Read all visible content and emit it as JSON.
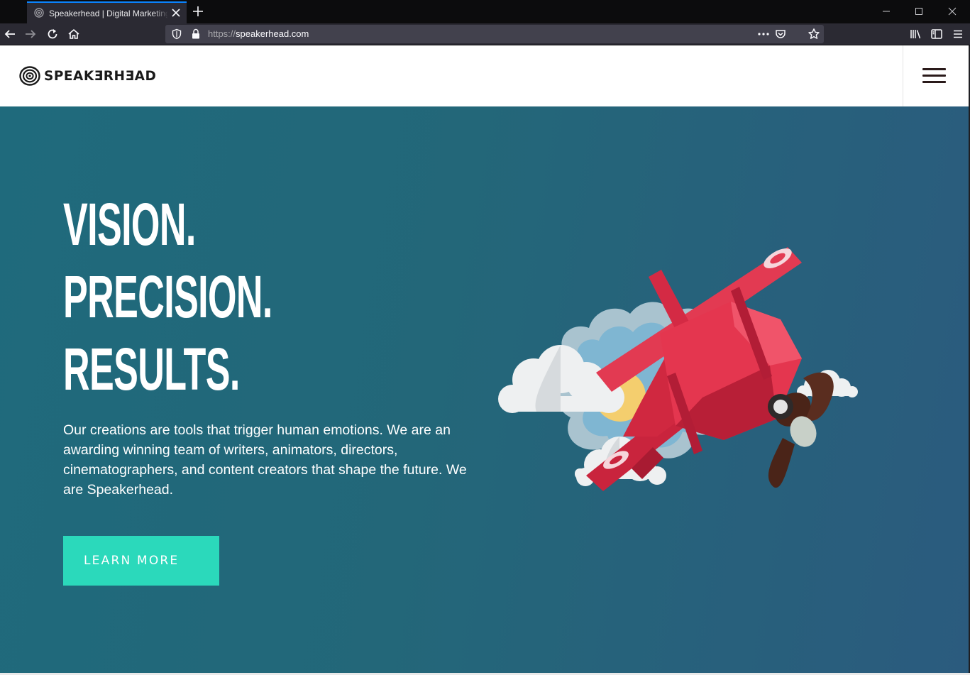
{
  "browser": {
    "tab_title": "Speakerhead | Digital Marketing",
    "url_protocol": "https://",
    "url_host": "speakerhead.com",
    "accent_color": "#0a84ff"
  },
  "icons": {
    "back": "arrow-left",
    "forward": "arrow-right",
    "reload": "reload",
    "home": "home",
    "tracking_protection": "shield",
    "lock": "lock",
    "page_actions": "ellipsis",
    "pocket": "pocket",
    "bookmark": "star",
    "library": "library",
    "sidebar": "sidebar",
    "menu": "hamburger",
    "site_menu": "hamburger"
  },
  "site": {
    "logo_text": "SPEAKƎRHƎAD",
    "headline": [
      "VISION.",
      "PRECISION.",
      "RESULTS."
    ],
    "description": "Our creations are tools that trigger human emotions. We are an awarding winning team of writers, animators, directors, cinematographers, and content creators that shape the future. We are Speakerhead.",
    "cta_label": "LEARN MORE",
    "cta_color": "#2bd9bb",
    "hero_color": "#236779"
  }
}
